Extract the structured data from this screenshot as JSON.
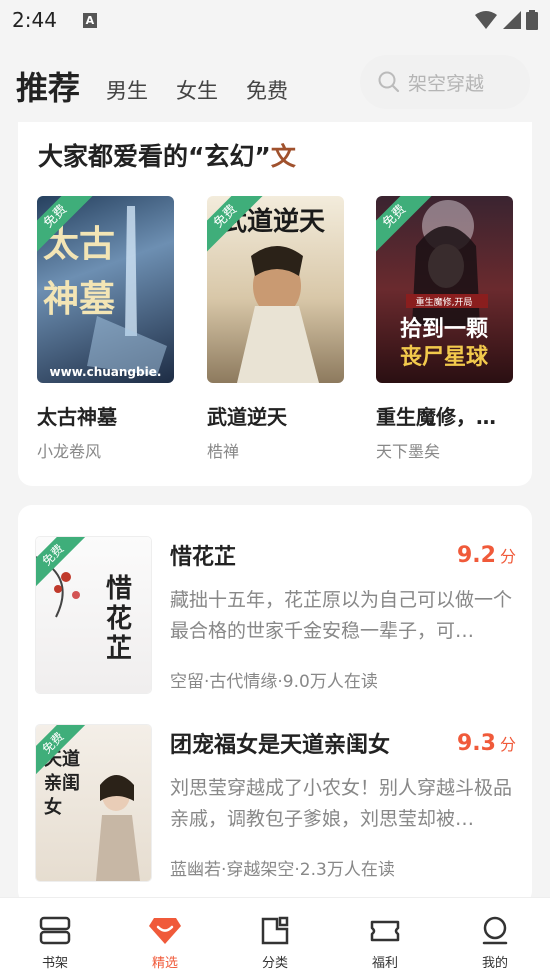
{
  "status": {
    "time": "2:44",
    "notif_letter": "A"
  },
  "header": {
    "tabs": [
      "推荐",
      "男生",
      "女生",
      "免费"
    ],
    "search_placeholder": "架空穿越"
  },
  "section1": {
    "title_main": "大家都爱看的“玄幻”",
    "title_accent": "文",
    "books": [
      {
        "name": "太古神墓",
        "author": "小龙卷风",
        "badge": "免费",
        "cover_text": "太古神墓",
        "cover_sub": "www.chuangbie."
      },
      {
        "name": "武道逆天",
        "author": "梏禅",
        "badge": "免费",
        "cover_text": "武道逆天",
        "cover_sub": ""
      },
      {
        "name": "重生魔修，…",
        "author": "天下墨矣",
        "badge": "免费",
        "cover_text": "拾到一颗丧尸星球",
        "cover_sub": "重生魔修,开局"
      }
    ]
  },
  "list": [
    {
      "name": "惜花芷",
      "score": "9.2",
      "unit": "分",
      "desc": "藏拙十五年，花芷原以为自己可以做一个最合格的世家千金安稳一辈子，可…",
      "meta": "空留·古代情缘·9.0万人在读",
      "badge": "免费",
      "cover_text": "惜花芷"
    },
    {
      "name": "团宠福女是天道亲闺女",
      "score": "9.3",
      "unit": "分",
      "desc": "刘思莹穿越成了小农女！别人穿越斗极品亲戚，调教包子爹娘，刘思莹却被…",
      "meta": "蓝幽若·穿越架空·2.3万人在读",
      "badge": "免费",
      "cover_text": "天道亲闺女"
    }
  ],
  "nav": [
    {
      "label": "书架",
      "icon": "bookshelf-icon"
    },
    {
      "label": "精选",
      "icon": "diamond-icon"
    },
    {
      "label": "分类",
      "icon": "category-icon"
    },
    {
      "label": "福利",
      "icon": "ticket-icon"
    },
    {
      "label": "我的",
      "icon": "profile-icon"
    }
  ],
  "colors": {
    "accent": "#f05a3a",
    "badge": "#3fae7a",
    "title_accent": "#a0512d"
  }
}
